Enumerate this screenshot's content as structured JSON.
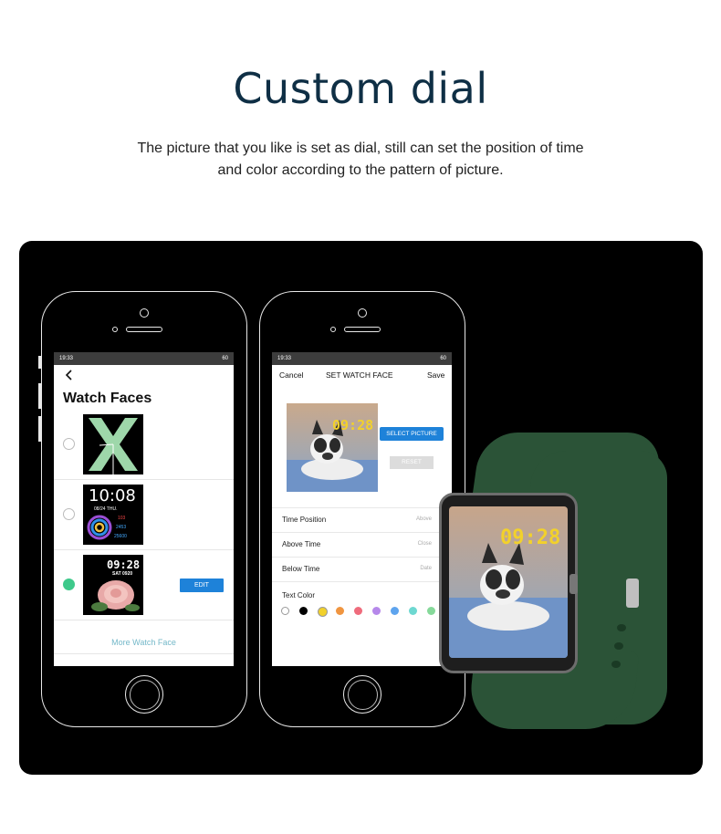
{
  "page": {
    "title": "Custom dial",
    "desc_line1": "The picture that you like is set as dial, still can set the position of time",
    "desc_line2": "and color according to the pattern of picture."
  },
  "status_bar": {
    "time": "19:33",
    "right": "60"
  },
  "screen1": {
    "back_icon": "chevron-left-icon",
    "title": "Watch Faces",
    "faces": [
      {
        "selected": false,
        "style": "green-x"
      },
      {
        "selected": false,
        "style": "digital",
        "time": "10:08",
        "date": "08/24 THU.",
        "stats": [
          "103",
          "2453",
          "25600"
        ]
      },
      {
        "selected": true,
        "style": "custom-photo",
        "time": "09:28",
        "date": "SAT 0920",
        "edit_label": "EDIT"
      }
    ],
    "more_label": "More Watch Face"
  },
  "screen2": {
    "cancel_label": "Cancel",
    "title": "SET WATCH FACE",
    "save_label": "Save",
    "preview_time": "09:28",
    "select_label": "SELECT PICTURE",
    "reset_label": "RESET",
    "settings": [
      {
        "label": "Time Position",
        "value": "Above"
      },
      {
        "label": "Above Time",
        "value": "Close"
      },
      {
        "label": "Below Time",
        "value": "Date"
      }
    ],
    "text_color_label": "Text Color",
    "colors": [
      "#ffffff",
      "#000000",
      "#f2d12b",
      "#f09540",
      "#ef6b7c",
      "#b688ea",
      "#5ea4ee",
      "#6ed8d1",
      "#86d99a"
    ],
    "selected_color": "#f2d12b"
  },
  "watch": {
    "time": "09:28",
    "strap_color": "#2b5337",
    "accent": "#f2d12b"
  }
}
